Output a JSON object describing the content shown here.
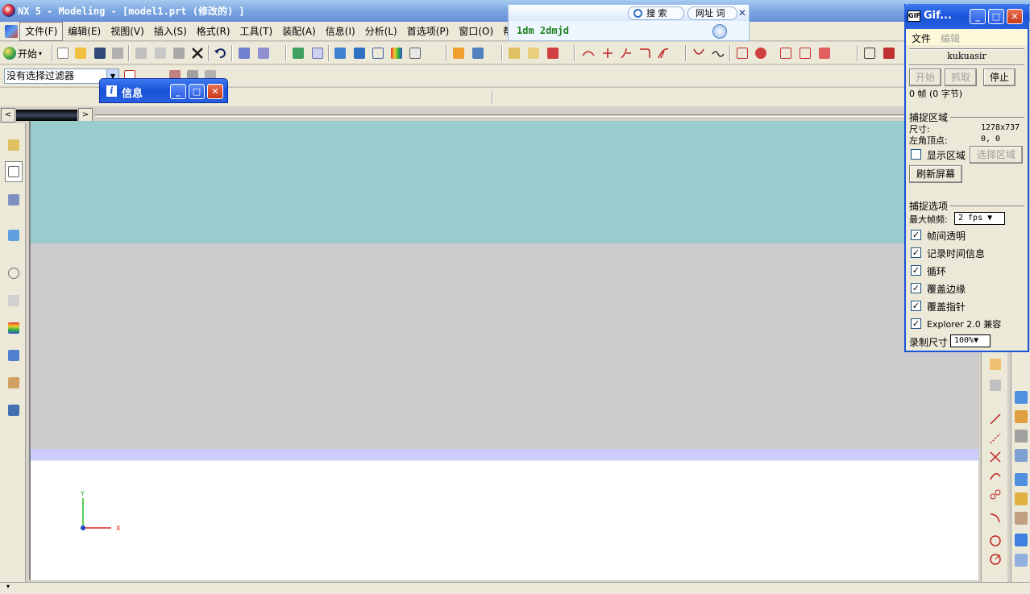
{
  "window": {
    "title": "NX 5 - Modeling - [model1.prt  (修改的) ]"
  },
  "menubar": {
    "items": [
      "文件(F)",
      "编辑(E)",
      "视图(V)",
      "插入(S)",
      "格式(R)",
      "工具(T)",
      "装配(A)",
      "信息(I)",
      "分析(L)",
      "首选项(P)",
      "窗口(O)",
      "帮助(H)"
    ]
  },
  "toolbar": {
    "start_label": "开始",
    "dropdown_glyph": "▾"
  },
  "selection": {
    "filter_value": "没有选择过滤器",
    "arrow": "▼"
  },
  "scroll": {
    "left_arrow": "<",
    "right_arrow": ">"
  },
  "triad": {
    "x_label": "X",
    "y_label": "Y"
  },
  "search": {
    "tab_search": "搜 索",
    "tab_url": "网址 词",
    "close": "✕",
    "text": "1dm 2dmjd"
  },
  "info_window": {
    "icon": "i",
    "title": "信息",
    "min": "_",
    "max": "□",
    "close": "✕"
  },
  "gif": {
    "icon": "GIF",
    "title": "Gif...",
    "min": "_",
    "max": "□",
    "close": "✕",
    "menu": [
      "文件",
      "编辑"
    ],
    "user": "kukuasir",
    "buttons": {
      "start": "开始",
      "capture": "抓取",
      "stop": "停止"
    },
    "frames": "0 帧 (0 字节)",
    "capture_area": {
      "heading": "捕捉区域",
      "size_label": "尺寸:",
      "size_value": "1278x737",
      "corner_label": "左角顶点:",
      "corner_value": "0, 0",
      "show_area": "显示区域",
      "select_area": "选择区域",
      "refresh": "刷新屏幕"
    },
    "options": {
      "heading": "捕捉选项",
      "max_fps_label": "最大帧频:",
      "max_fps_value": "2 fps ▼",
      "checks": [
        "帧间透明",
        "记录时间信息",
        "循环",
        "覆盖边缘",
        "覆盖指针",
        "Explorer 2.0 兼容"
      ],
      "check_mark": "✓",
      "size_label": "录制尺寸",
      "size_value": "100%▼"
    }
  },
  "colors": {
    "teal_band": "#99cccc",
    "gray_band": "#cccccc",
    "lavender_band": "#ccccff",
    "title_blue": "#1a52d8",
    "search_text": "#208020"
  }
}
